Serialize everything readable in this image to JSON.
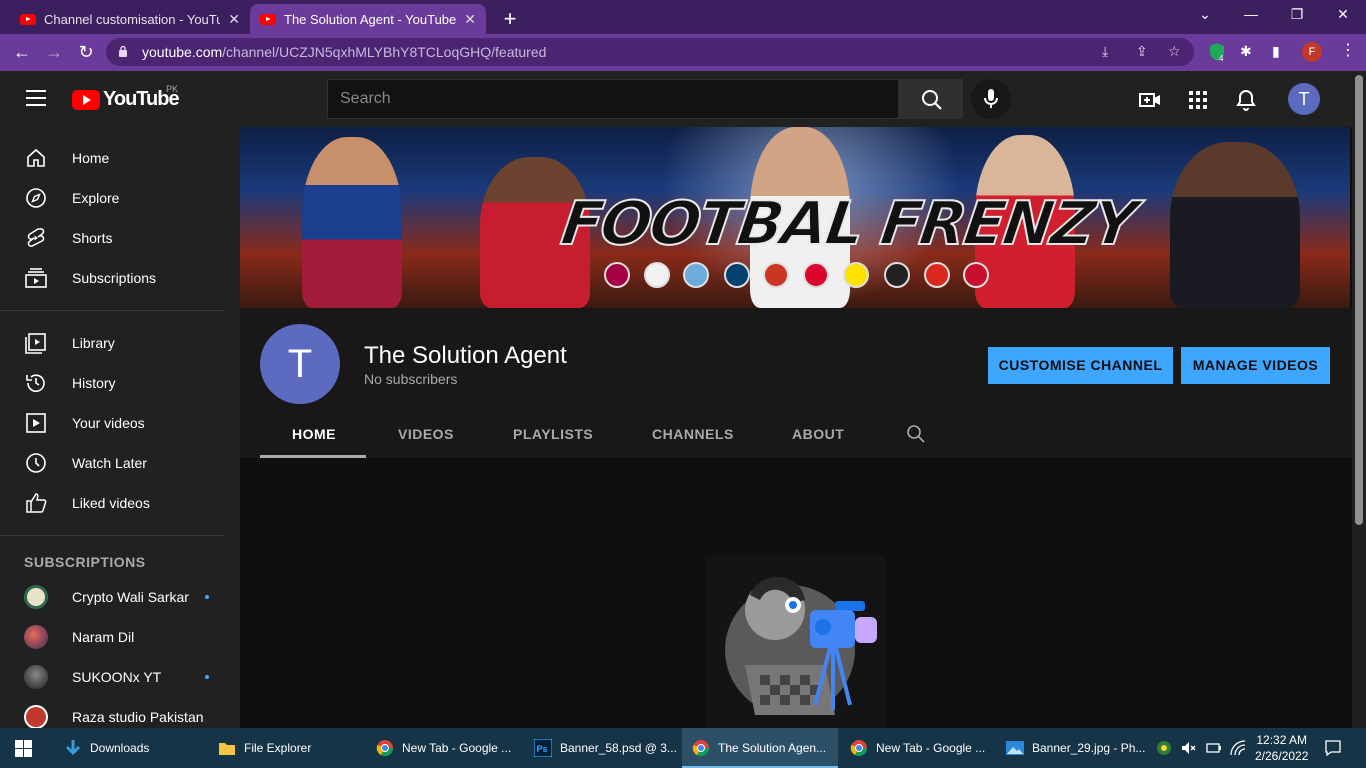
{
  "browser": {
    "tabs": [
      {
        "title": "Channel customisation - YouTube",
        "active": false
      },
      {
        "title": "The Solution Agent - YouTube",
        "active": true
      }
    ],
    "url_host": "youtube.com",
    "url_path": "/channel/UCZJN5qxhMLYBhY8TCLoqGHQ/featured",
    "profile_initial": "F",
    "extension_badge": "4"
  },
  "youtube": {
    "logo_text": "YouTube",
    "country_code": "PK",
    "search_placeholder": "Search",
    "user_initial": "T"
  },
  "sidebar": {
    "main": [
      {
        "label": "Home",
        "icon": "home-icon"
      },
      {
        "label": "Explore",
        "icon": "compass-icon"
      },
      {
        "label": "Shorts",
        "icon": "shorts-icon"
      },
      {
        "label": "Subscriptions",
        "icon": "subscriptions-icon"
      }
    ],
    "library": [
      {
        "label": "Library",
        "icon": "library-icon"
      },
      {
        "label": "History",
        "icon": "history-icon"
      },
      {
        "label": "Your videos",
        "icon": "your-videos-icon"
      },
      {
        "label": "Watch Later",
        "icon": "clock-icon"
      },
      {
        "label": "Liked videos",
        "icon": "thumbs-up-icon"
      }
    ],
    "subscriptions_heading": "SUBSCRIPTIONS",
    "subscriptions": [
      {
        "name": "Crypto Wali Sarkar",
        "new": true,
        "color": "#e9e2c8"
      },
      {
        "name": "Naram Dil",
        "new": false,
        "color": "#7a4a6a"
      },
      {
        "name": "SUKOONx YT",
        "new": true,
        "color": "#444444"
      },
      {
        "name": "Raza studio Pakistan",
        "new": false,
        "color": "#c0392b"
      }
    ]
  },
  "channel": {
    "banner_title": "FOOTBAL FRENZY",
    "avatar_initial": "T",
    "name": "The Solution Agent",
    "subscribers": "No subscribers",
    "customise_label": "CUSTOMISE CHANNEL",
    "manage_label": "MANAGE VIDEOS",
    "tabs": [
      "HOME",
      "VIDEOS",
      "PLAYLISTS",
      "CHANNELS",
      "ABOUT"
    ],
    "active_tab": "HOME"
  },
  "taskbar": {
    "items": [
      {
        "label": "Downloads",
        "icon": "download-icon"
      },
      {
        "label": "File Explorer",
        "icon": "folder-icon"
      },
      {
        "label": "New Tab - Google ...",
        "icon": "chrome-icon"
      },
      {
        "label": "Banner_58.psd @ 3...",
        "icon": "photoshop-icon"
      },
      {
        "label": "The Solution Agen...",
        "icon": "chrome-icon"
      },
      {
        "label": "New Tab - Google ...",
        "icon": "chrome-icon"
      },
      {
        "label": "Banner_29.jpg - Ph...",
        "icon": "photos-icon"
      }
    ],
    "time": "12:32 AM",
    "date": "2/26/2022"
  },
  "colors": {
    "accent_blue": "#3ea6ff",
    "youtube_red": "#ff0000",
    "chrome_purple": "#6a3b9a",
    "avatar_purple": "#5c6bc0"
  }
}
